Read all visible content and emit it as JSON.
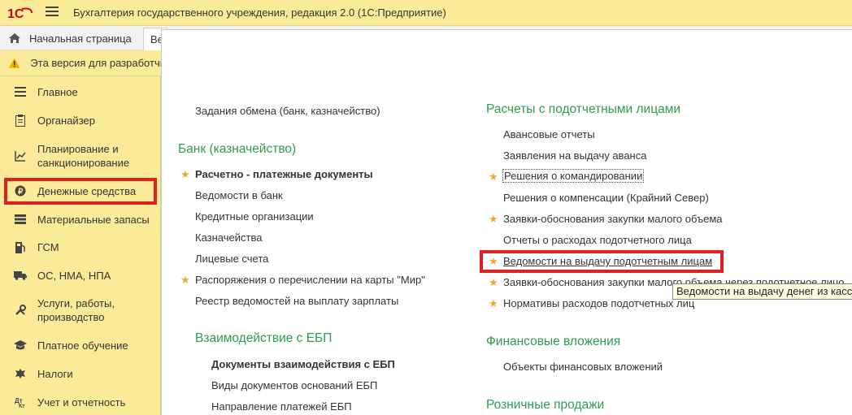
{
  "titlebar": {
    "title": "Бухгалтерия государственного учреждения, редакция 2.0  (1С:Предприятие)"
  },
  "tabs": {
    "home_label": "Начальная страница",
    "current_label": "Ве"
  },
  "warning": {
    "text": "Эта версия для разработчи"
  },
  "sidebar": {
    "items": [
      {
        "label": "Главное",
        "icon": "menu-lines-icon"
      },
      {
        "label": "Органайзер",
        "icon": "clipboard-icon"
      },
      {
        "label": "Планирование и санкционирование",
        "icon": "chart-icon"
      },
      {
        "label": "Денежные средства",
        "icon": "ruble-coin-icon"
      },
      {
        "label": "Материальные запасы",
        "icon": "stack-icon"
      },
      {
        "label": "ГСМ",
        "icon": "fuel-icon"
      },
      {
        "label": "ОС, НМА, НПА",
        "icon": "truck-icon"
      },
      {
        "label": "Услуги, работы, производство",
        "icon": "tools-icon"
      },
      {
        "label": "Платное обучение",
        "icon": "graduation-cap-icon"
      },
      {
        "label": "Налоги",
        "icon": "emblem-icon"
      },
      {
        "label": "Учет и отчетность",
        "icon": "accounting-icon"
      }
    ]
  },
  "left_col": {
    "exchange_tasks": "Задания обмена (банк, казначейство)",
    "bank_section": "Банк (казначейство)",
    "bank_links": [
      "Расчетно - платежные документы",
      "Ведомости в банк",
      "Кредитные организации",
      "Казначейства",
      "Лицевые счета",
      "Распоряжения о перечислении на карты \"Мир\"",
      "Реестр ведомостей на выплату зарплаты"
    ],
    "ebp_section": "Взаимодействие с ЕБП",
    "ebp_links": [
      "Документы взаимодействия с ЕБП",
      "Виды документов оснований ЕБП",
      "Направление платежей ЕБП"
    ]
  },
  "right_col": {
    "accountable_section": "Расчеты с подотчетными лицами",
    "accountable_links": [
      "Авансовые отчеты",
      "Заявления на выдачу аванса",
      "Решения о командировании",
      "Решения о компенсации (Крайний Север)",
      "Заявки-обоснования закупки малого объема",
      "Отчеты о расходах подотчетного лица",
      "Ведомости на выдачу подотчетным лицам",
      "Заявки-обоснования закупки малого объема через подотчетное лицо",
      "Нормативы расходов подотчетных лиц"
    ],
    "financial_section": "Финансовые вложения",
    "financial_links": [
      "Объекты финансовых вложений"
    ],
    "retail_section": "Розничные продажи"
  },
  "tooltip": {
    "text": "Ведомости на выдачу денег из касс"
  },
  "colors": {
    "accent_yellow": "#fbeb98",
    "section_green": "#2e9b4e",
    "highlight_red": "#e02020",
    "star_orange": "#f0a830"
  }
}
